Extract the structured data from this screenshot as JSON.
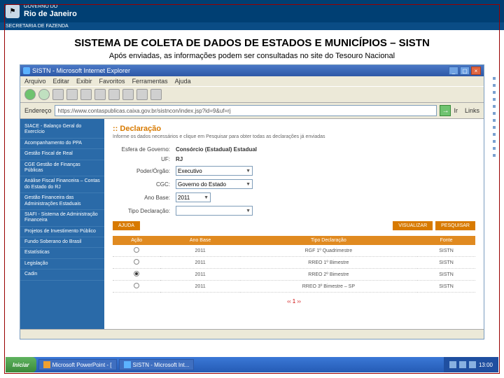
{
  "header": {
    "gov_small": "GOVERNO DO",
    "gov_big": "Rio de Janeiro",
    "secretaria": "SECRETARIA DE FAZENDA"
  },
  "slide": {
    "title": "SISTEMA DE COLETA DE DADOS DE ESTADOS E MUNICÍPIOS – SISTN",
    "subtitle": "Após enviadas, as informações podem ser consultadas no site do Tesouro Nacional"
  },
  "ie": {
    "title": "SISTN - Microsoft Internet Explorer",
    "menu": [
      "Arquivo",
      "Editar",
      "Exibir",
      "Favoritos",
      "Ferramentas",
      "Ajuda"
    ],
    "address": "https://www.contaspublicas.caixa.gov.br/sistncon/index.jsp?id=9&uf=rj",
    "go": "Ir"
  },
  "sidebar": {
    "items": [
      "SIACE - Balanço Geral do Exercício",
      "Acompanhamento do PPA",
      "Gestão Fiscal de Real",
      "CGE Gestão de Finanças Públicas",
      "Análise Fiscal Financeira – Contas do Estado do RJ",
      "Gestão Financeira das Administrações Estaduais",
      "SIAFI - Sistema de Administração Financeira",
      "Projetos de Investimento Público",
      "Fundo Soberano do Brasil",
      "Estatísticas",
      "Legislação",
      "Cadin"
    ]
  },
  "page": {
    "decl_title": ":: Declaração",
    "decl_sub": "Informe os dados necessários e clique em Pesquisar para obter todas as declarações já enviadas",
    "form": {
      "esfera_label": "Esfera de Governo:",
      "esfera_val": "Consórcio (Estadual) Estadual",
      "uf_label": "UF:",
      "uf_val": "RJ",
      "poder_label": "Poder/Órgão:",
      "poder_sel": "Executivo",
      "cgc_label": "CGC:",
      "cgc_sel": "Governo do Estado",
      "ano_label": "Ano Base:",
      "ano_sel": "2011",
      "tipo_label": "Tipo Declaração:",
      "tipo_sel": ""
    },
    "buttons": {
      "ajuda": "AJUDA",
      "visualizar": "VISUALIZAR",
      "pesquisar": "PESQUISAR"
    },
    "table": {
      "headers": [
        "Ação",
        "Ano Base",
        "Tipo Declaração",
        "Fonte"
      ],
      "rows": [
        {
          "checked": false,
          "ano": "2011",
          "tipo": "RGF 1º Quadrimestre",
          "fonte": "SISTN"
        },
        {
          "checked": false,
          "ano": "2011",
          "tipo": "RREO 1º Bimestre",
          "fonte": "SISTN"
        },
        {
          "checked": true,
          "ano": "2011",
          "tipo": "RREO 2º Bimestre",
          "fonte": "SISTN"
        },
        {
          "checked": false,
          "ano": "2011",
          "tipo": "RREO 3º Bimestre – SP",
          "fonte": "SISTN"
        }
      ]
    },
    "pager": "‹‹ 1 ››"
  },
  "taskbar": {
    "start": "Iniciar",
    "items": [
      "Microsoft PowerPoint - [",
      "SISTN - Microsoft Int..."
    ],
    "time": "13:00"
  }
}
